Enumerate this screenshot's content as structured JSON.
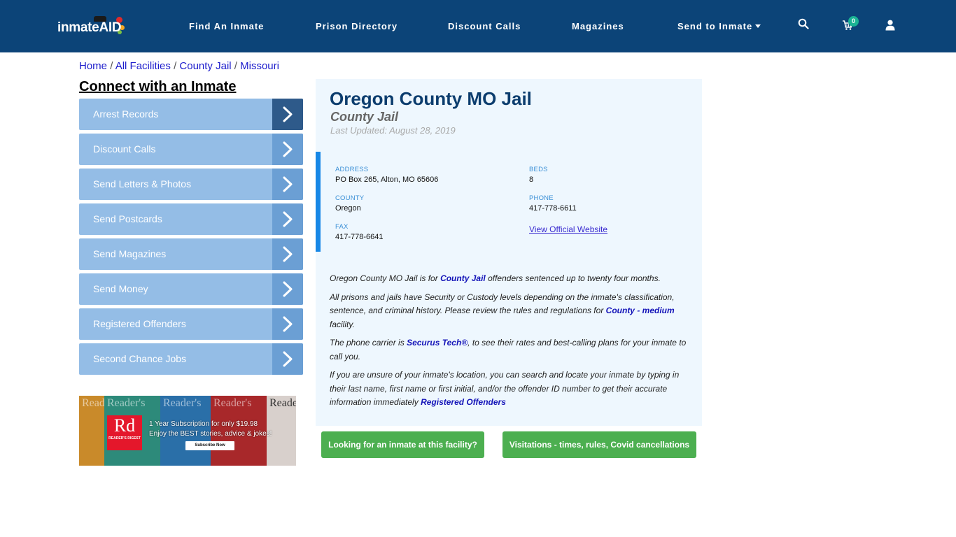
{
  "header": {
    "logo": {
      "text_main": "inmate",
      "text_accent": "AID"
    },
    "nav": [
      {
        "label": "Find An Inmate"
      },
      {
        "label": "Prison Directory"
      },
      {
        "label": "Discount Calls"
      },
      {
        "label": "Magazines"
      },
      {
        "label": "Send to Inmate",
        "has_dropdown": true
      }
    ],
    "icons": {
      "search": "search-icon",
      "cart": "cart-icon",
      "user": "user-icon"
    },
    "cart_count": "0",
    "colors": {
      "background": "#0c4478",
      "badge": "#1ab394"
    }
  },
  "breadcrumb": {
    "items": [
      {
        "label": "Home"
      },
      {
        "label": "All Facilities"
      },
      {
        "label": "County Jail"
      },
      {
        "label": "Missouri"
      }
    ],
    "separator": "/"
  },
  "sidebar": {
    "title": "Connect with an Inmate",
    "items": [
      {
        "label": "Arrest Records",
        "active": true
      },
      {
        "label": "Discount Calls"
      },
      {
        "label": "Send Letters & Photos"
      },
      {
        "label": "Send Postcards"
      },
      {
        "label": "Send Magazines"
      },
      {
        "label": "Send Money"
      },
      {
        "label": "Registered Offenders"
      },
      {
        "label": "Second Chance Jobs"
      }
    ],
    "ad": {
      "cover_title": "Reader's",
      "brand_short": "Rd",
      "brand_name": "READER'S DIGEST",
      "line1": "1 Year Subscription for only $19.98",
      "line2": "Enjoy the BEST stories, advice & jokes!",
      "cta": "Subscribe Now"
    }
  },
  "facility": {
    "title": "Oregon County MO Jail",
    "type": "County Jail",
    "last_updated": "Last Updated: August 28, 2019",
    "info": {
      "address_label": "ADDRESS",
      "address": "PO Box 265, Alton, MO 65606",
      "county_label": "COUNTY",
      "county": "Oregon",
      "fax_label": "FAX",
      "fax": "417-778-6641",
      "beds_label": "BEDS",
      "beds": "8",
      "phone_label": "PHONE",
      "phone": "417-778-6611",
      "website_link": "View Official Website"
    },
    "description": {
      "p1_pre": "Oregon County MO Jail is for ",
      "p1_link": "County Jail",
      "p1_post": " offenders sentenced up to twenty four months.",
      "p2_pre": "All prisons and jails have Security or Custody levels depending on the inmate's classification, sentence, and criminal history. Please review the rules and regulations for ",
      "p2_link": "County - medium",
      "p2_post": " facility.",
      "p3_pre": "The phone carrier is ",
      "p3_link": "Securus Tech®",
      "p3_post": ", to see their rates and best-calling plans for your inmate to call you.",
      "p4_pre": "If you are unsure of your inmate's location, you can search and locate your inmate by typing in their last name, first name or first initial, and/or the offender ID number to get their accurate information immediately ",
      "p4_link": "Registered Offenders"
    }
  },
  "actions": {
    "find_inmate": "Looking for an inmate at this facility?",
    "visitation": "Visitations - times, rules, Covid cancellations",
    "color": "#4caf50"
  }
}
